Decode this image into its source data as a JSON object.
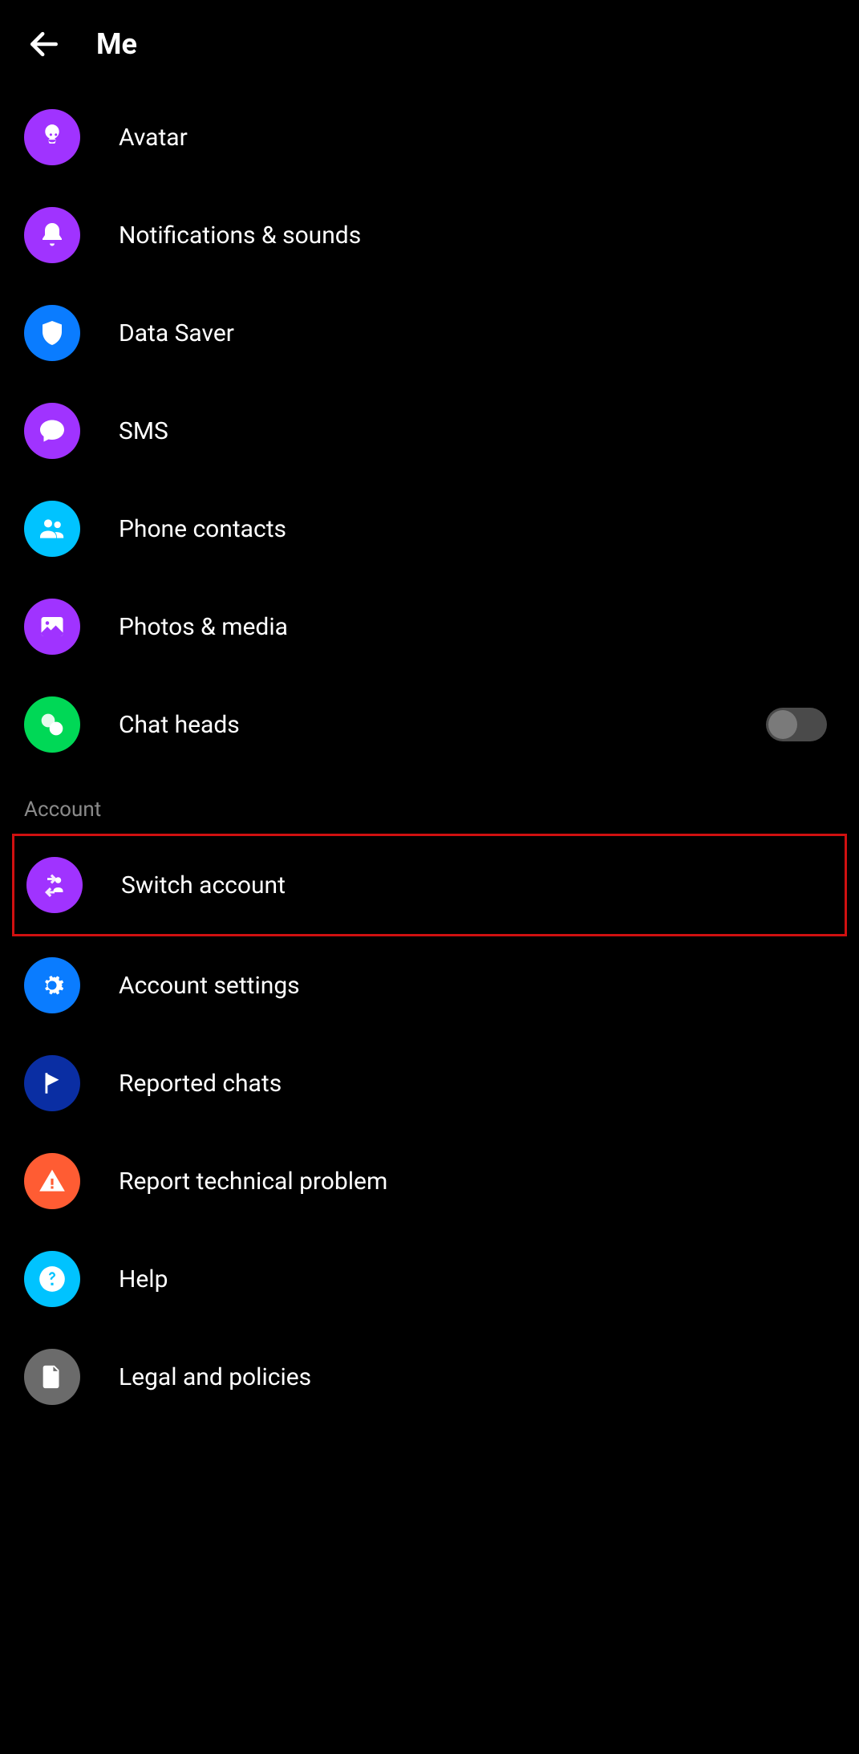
{
  "header": {
    "title": "Me"
  },
  "preferences": [
    {
      "id": "avatar",
      "label": "Avatar",
      "icon": "avatar-icon",
      "color": "purple"
    },
    {
      "id": "notifications",
      "label": "Notifications & sounds",
      "icon": "bell-icon",
      "color": "purple"
    },
    {
      "id": "datasaver",
      "label": "Data Saver",
      "icon": "shield-icon",
      "color": "blue"
    },
    {
      "id": "sms",
      "label": "SMS",
      "icon": "chat-icon",
      "color": "purple"
    },
    {
      "id": "contacts",
      "label": "Phone contacts",
      "icon": "people-icon",
      "color": "cyan"
    },
    {
      "id": "photos",
      "label": "Photos & media",
      "icon": "image-icon",
      "color": "purple"
    },
    {
      "id": "chatheads",
      "label": "Chat heads",
      "icon": "chatheads-icon",
      "color": "green",
      "toggle": false
    }
  ],
  "account_header": "Account",
  "account": [
    {
      "id": "switch",
      "label": "Switch account",
      "icon": "switch-icon",
      "color": "purple",
      "highlighted": true
    },
    {
      "id": "settings",
      "label": "Account settings",
      "icon": "gear-icon",
      "color": "blue"
    },
    {
      "id": "reported",
      "label": "Reported chats",
      "icon": "flag-icon",
      "color": "darkblue"
    },
    {
      "id": "report",
      "label": "Report technical problem",
      "icon": "warning-icon",
      "color": "orange"
    },
    {
      "id": "help",
      "label": "Help",
      "icon": "help-icon",
      "color": "cyan"
    },
    {
      "id": "legal",
      "label": "Legal and policies",
      "icon": "document-icon",
      "color": "grey"
    }
  ]
}
